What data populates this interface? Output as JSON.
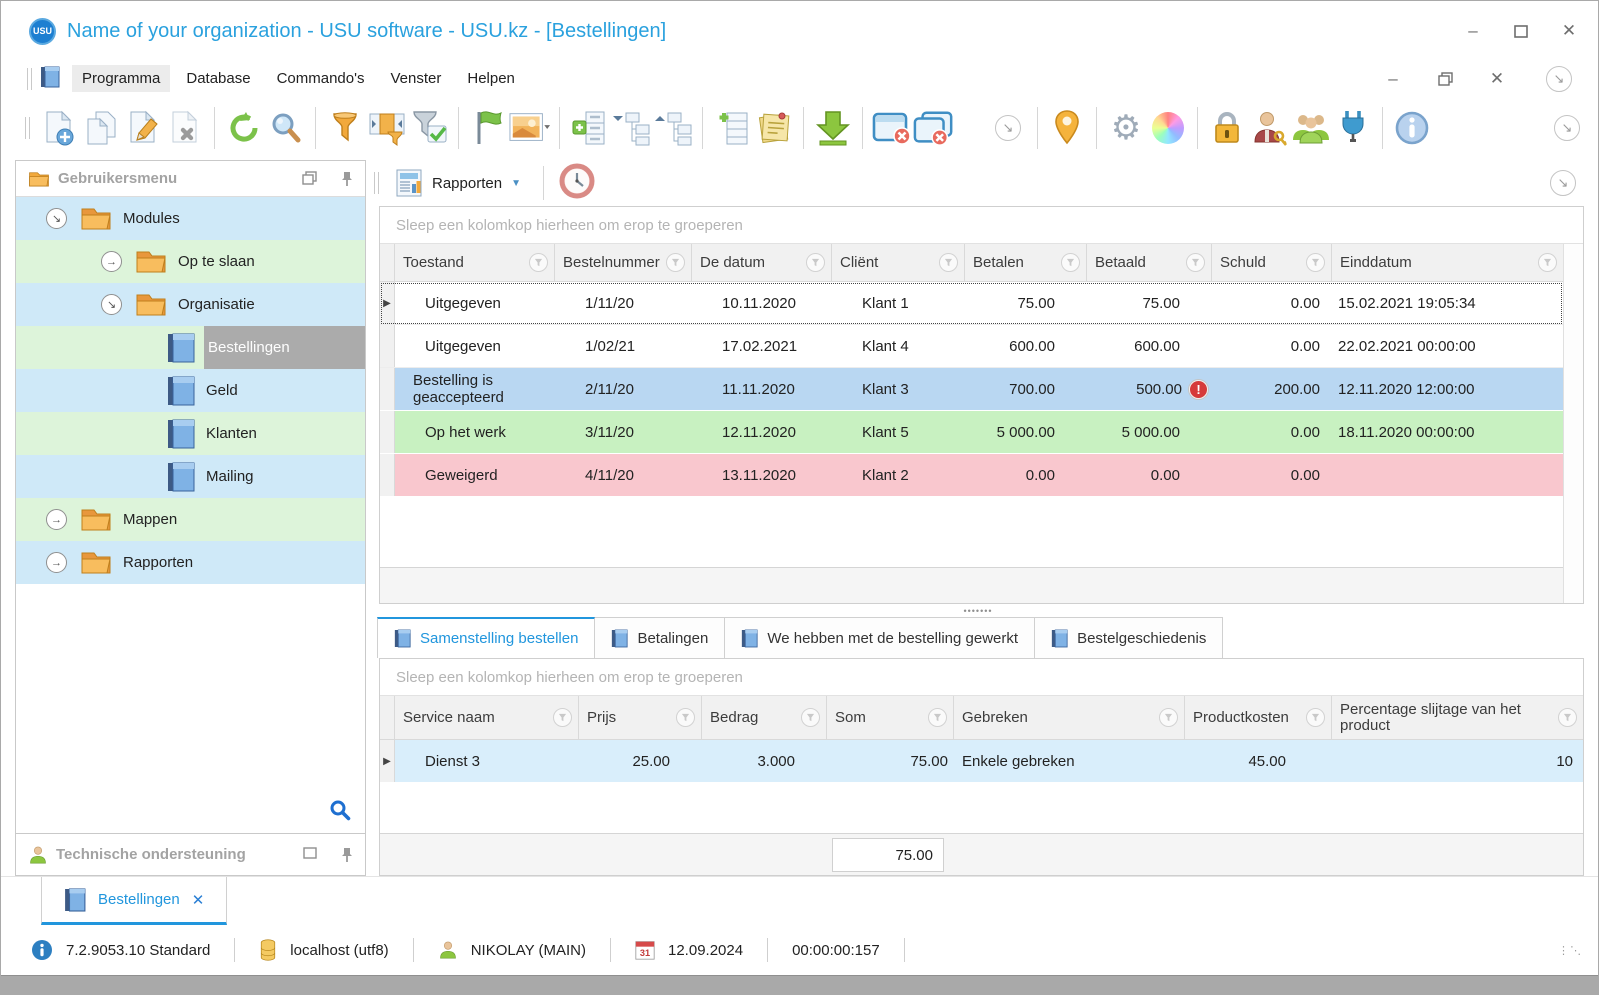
{
  "window": {
    "title": "Name of your organization - USU software - USU.kz - [Bestellingen]",
    "logo_text": "USU"
  },
  "menu": {
    "items": [
      "Programma",
      "Database",
      "Commando's",
      "Venster",
      "Helpen"
    ]
  },
  "toolbar": {
    "icons": [
      "new-document",
      "copy-document",
      "edit-document",
      "delete-document",
      "refresh",
      "search",
      "filter",
      "filter-columns",
      "filter-confirm",
      "flag",
      "image",
      "add-group",
      "collapse-tree",
      "expand-tree",
      "add-row",
      "notes",
      "download",
      "close-window",
      "close-all-windows",
      "overflow",
      "location-pin",
      "settings-gear",
      "color-wheel",
      "lock",
      "user-key",
      "user-group",
      "plugin",
      "info"
    ]
  },
  "sidebar": {
    "title": "Gebruikersmenu",
    "tree": [
      {
        "label": "Modules"
      },
      {
        "label": "Op te slaan"
      },
      {
        "label": "Organisatie"
      },
      {
        "label": "Bestellingen"
      },
      {
        "label": "Geld"
      },
      {
        "label": "Klanten"
      },
      {
        "label": "Mailing"
      },
      {
        "label": "Mappen"
      },
      {
        "label": "Rapporten"
      }
    ],
    "support_panel": "Technische ondersteuning"
  },
  "report_bar": {
    "button_label": "Rapporten"
  },
  "group_panel_text": "Sleep een kolomkop hierheen om erop te groeperen",
  "orders_grid": {
    "columns": [
      "Toestand",
      "Bestelnummer",
      "De datum",
      "Cliënt",
      "Betalen",
      "Betaald",
      "Schuld",
      "Einddatum"
    ],
    "rows": [
      {
        "toestand": "Uitgegeven",
        "nummer": "1/11/20",
        "datum": "10.11.2020",
        "client": "Klant 1",
        "betalen": "75.00",
        "betaald": "75.00",
        "schuld": "0.00",
        "eind": "15.02.2021 19:05:34"
      },
      {
        "toestand": "Uitgegeven",
        "nummer": "1/02/21",
        "datum": "17.02.2021",
        "client": "Klant 4",
        "betalen": "600.00",
        "betaald": "600.00",
        "schuld": "0.00",
        "eind": "22.02.2021 00:00:00"
      },
      {
        "toestand": "Bestelling is geaccepteerd",
        "nummer": "2/11/20",
        "datum": "11.11.2020",
        "client": "Klant 3",
        "betalen": "700.00",
        "betaald": "500.00",
        "schuld": "200.00",
        "eind": "12.11.2020 12:00:00",
        "warning": "!"
      },
      {
        "toestand": "Op het werk",
        "nummer": "3/11/20",
        "datum": "12.11.2020",
        "client": "Klant 5",
        "betalen": "5 000.00",
        "betaald": "5 000.00",
        "schuld": "0.00",
        "eind": "18.11.2020 00:00:00"
      },
      {
        "toestand": "Geweigerd",
        "nummer": "4/11/20",
        "datum": "13.11.2020",
        "client": "Klant 2",
        "betalen": "0.00",
        "betaald": "0.00",
        "schuld": "0.00",
        "eind": ""
      }
    ]
  },
  "detail_tabs": [
    "Samenstelling bestellen",
    "Betalingen",
    "We hebben met de bestelling gewerkt",
    "Bestelgeschiedenis"
  ],
  "services_grid": {
    "columns": [
      "Service naam",
      "Prijs",
      "Bedrag",
      "Som",
      "Gebreken",
      "Productkosten",
      "Percentage slijtage van het product"
    ],
    "rows": [
      {
        "naam": "Dienst 3",
        "prijs": "25.00",
        "bedrag": "3.000",
        "som": "75.00",
        "gebreken": "Enkele gebreken",
        "kosten": "45.00",
        "slijtage": "10"
      }
    ],
    "summary_som": "75.00"
  },
  "mdi_tab": {
    "label": "Bestellingen",
    "close": "✕"
  },
  "status_bar": {
    "version": "7.2.9053.10 Standard",
    "database": "localhost (utf8)",
    "user": "NIKOLAY (MAIN)",
    "date": "12.09.2024",
    "timer": "00:00:00:157"
  },
  "colors": {
    "accent_blue": "#2aa1de",
    "row_blue": "#b9d7f2",
    "row_green": "#c8f1c1",
    "row_pink": "#f9c7ce",
    "selected_node_bg": "#ababab",
    "warning_red": "#d63a3a"
  }
}
